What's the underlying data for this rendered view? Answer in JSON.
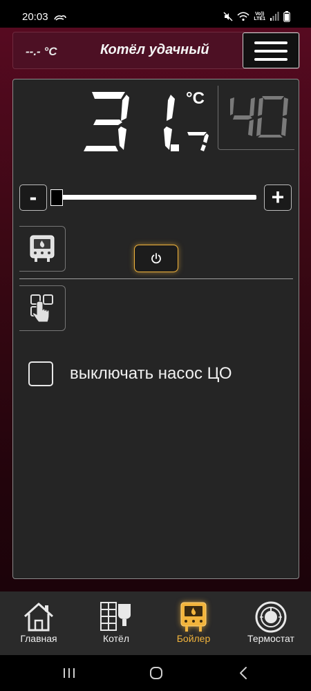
{
  "status_bar": {
    "time": "20:03",
    "network_label": "Vo))\nLTE1",
    "network_top": "Vo))",
    "network_bottom": "LTE1"
  },
  "header": {
    "outside_temp": "--.- °C",
    "title": "Котёл удачный",
    "menu_icon": "hamburger-menu-icon"
  },
  "display": {
    "current_temp": 31.7,
    "current_temp_text": "31.7",
    "unit": "°C",
    "setpoint": 40,
    "setpoint_text": "40",
    "digit_color": "#ffffff",
    "setpoint_color": "#7a7a7a"
  },
  "slider": {
    "minus_label": "-",
    "plus_label": "+",
    "level": 0.0
  },
  "boiler_section": {
    "boiler_icon": "boiler-icon",
    "power_icon": "power-icon",
    "touch_icon": "touch-control-icon"
  },
  "pump_option": {
    "checked": false,
    "label": "выключать насос ЦО"
  },
  "bottom_nav": {
    "items": [
      {
        "label": "Главная",
        "icon": "home-icon",
        "active": false
      },
      {
        "label": "Котёл",
        "icon": "boiler-kettle-icon",
        "active": false
      },
      {
        "label": "Бойлер",
        "icon": "boiler-icon",
        "active": true
      },
      {
        "label": "Термостат",
        "icon": "thermostat-icon",
        "active": false
      }
    ],
    "active_color": "#f2b43c"
  },
  "system_nav": {
    "recent_icon": "recent-apps-icon",
    "home_icon": "home-circle-icon",
    "back_icon": "back-icon"
  },
  "colors": {
    "accent": "#f2b43c",
    "header_bg": "#4d1024",
    "panel_bg": "#252525"
  }
}
